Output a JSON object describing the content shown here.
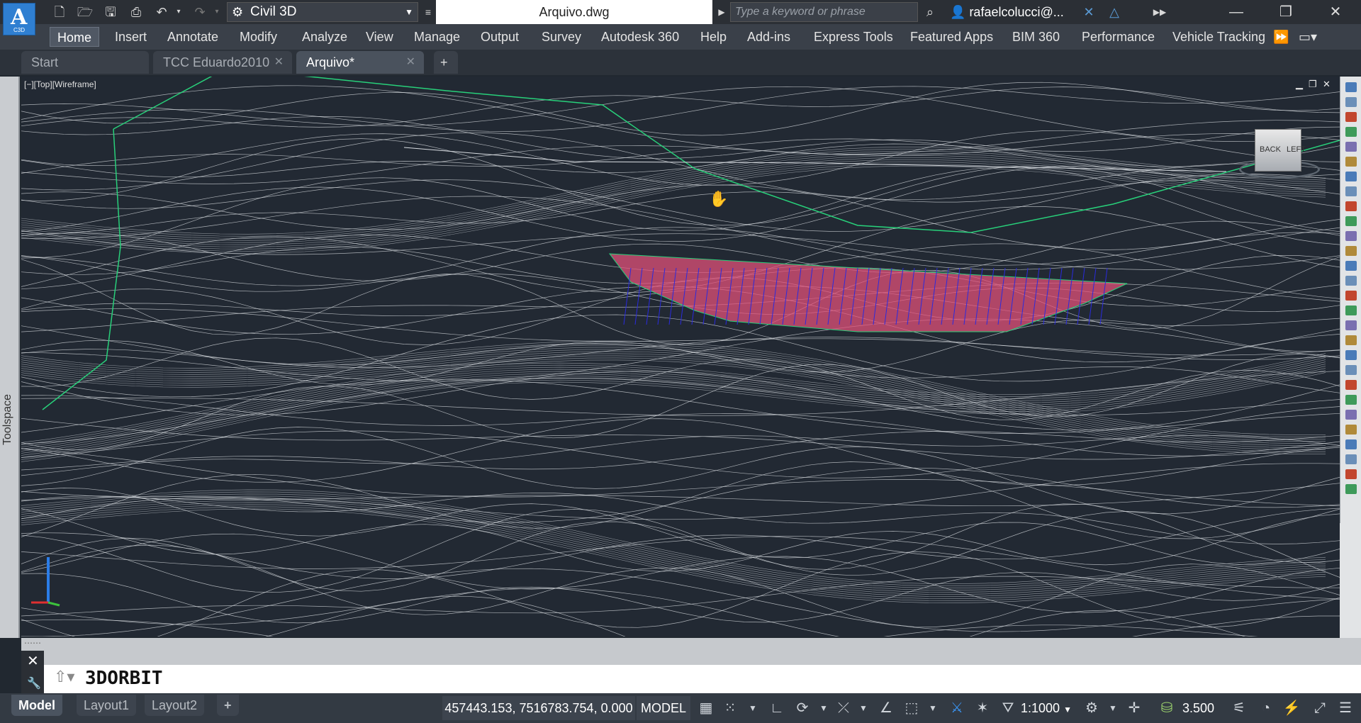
{
  "app": {
    "logo_letter": "A",
    "logo_sub": "C3D",
    "workspace": "Civil 3D",
    "document_title": "Arquivo.dwg",
    "search_placeholder": "Type a keyword or phrase",
    "user": "rafaelcolucci@..."
  },
  "ribbon": {
    "tabs": [
      {
        "label": "Home"
      },
      {
        "label": "Insert"
      },
      {
        "label": "Annotate"
      },
      {
        "label": "Modify"
      },
      {
        "label": "Analyze"
      },
      {
        "label": "View"
      },
      {
        "label": "Manage"
      },
      {
        "label": "Output"
      },
      {
        "label": "Survey"
      },
      {
        "label": "Autodesk 360"
      },
      {
        "label": "Help"
      },
      {
        "label": "Add-ins"
      },
      {
        "label": "Express Tools"
      },
      {
        "label": "Featured Apps"
      },
      {
        "label": "BIM 360"
      },
      {
        "label": "Performance"
      },
      {
        "label": "Vehicle Tracking"
      }
    ]
  },
  "document_tabs": [
    {
      "label": "Start"
    },
    {
      "label": "TCC Eduardo2010"
    },
    {
      "label": "Arquivo*"
    }
  ],
  "toolspace": {
    "label": "Toolspace"
  },
  "viewport": {
    "view_label": "[−][Top][Wireframe]",
    "viewcube_back": "BACK",
    "viewcube_left": "LEFT"
  },
  "command": {
    "current": "3DORBIT"
  },
  "status": {
    "layout_tabs": [
      {
        "label": "Model"
      },
      {
        "label": "Layout1"
      },
      {
        "label": "Layout2"
      }
    ],
    "coordinates": "457443.153, 7516783.754, 0.000",
    "space": "MODEL",
    "annotation_scale": "1:1000",
    "value": "3.500"
  },
  "colors": {
    "background": "#222933",
    "contour": "#d9dde2",
    "boundary": "#28d07a",
    "corridor_fill": "#e0507a",
    "corridor_lines": "#2a2ae0"
  }
}
